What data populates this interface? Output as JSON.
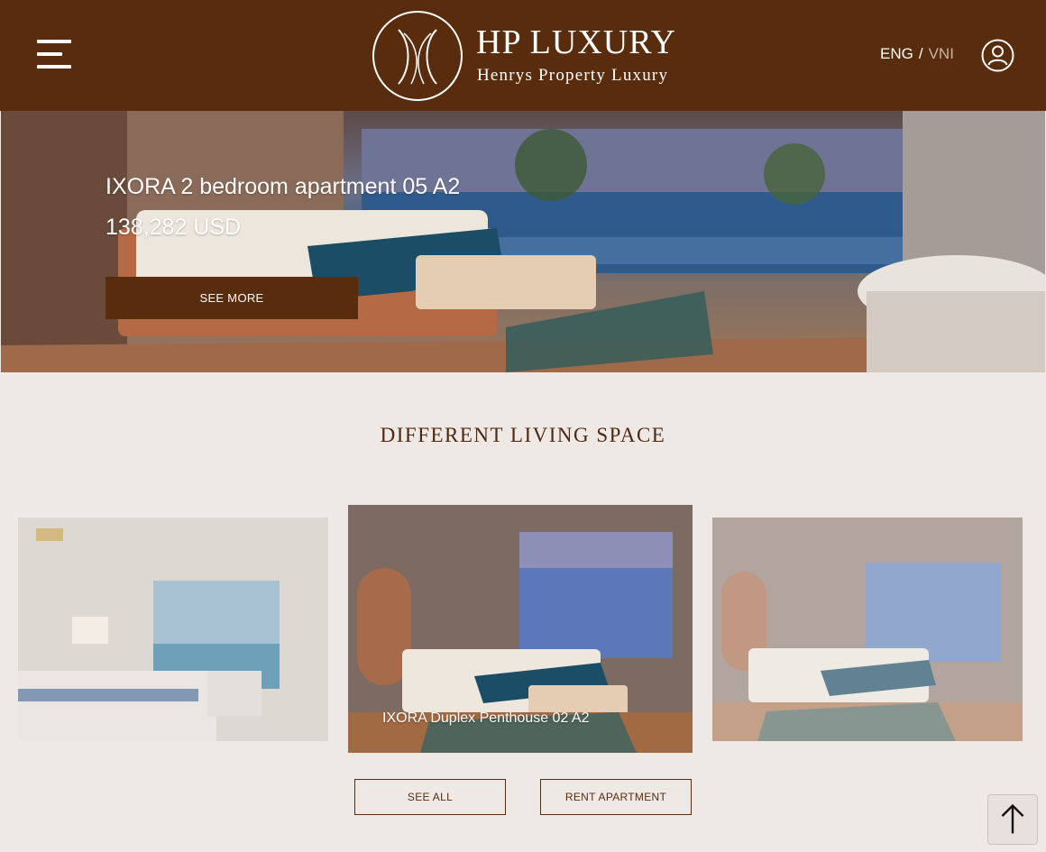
{
  "header": {
    "logo_title": "HP LUXURY",
    "logo_subtitle": "Henrys Property Luxury",
    "lang_active": "ENG",
    "lang_separator": "/",
    "lang_inactive": "VNI",
    "icons": {
      "menu": "hamburger-menu-icon",
      "user": "user-account-icon"
    }
  },
  "hero": {
    "title": "IXORA 2 bedroom apartment 05 A2",
    "price": "138,282 USD",
    "button_label": "SEE MORE"
  },
  "section": {
    "title": "DIFFERENT LIVING SPACE",
    "cards": [
      {
        "caption": ""
      },
      {
        "caption": "IXORA Duplex Penthouse 02 A2"
      },
      {
        "caption": ""
      }
    ],
    "see_all_label": "SEE ALL",
    "rent_label": "RENT APARTMENT"
  },
  "colors": {
    "brand_brown": "#5a2c0e",
    "page_background": "#efe9e6",
    "section_title": "#4e2810"
  },
  "back_to_top_icon": "arrow-up-icon"
}
